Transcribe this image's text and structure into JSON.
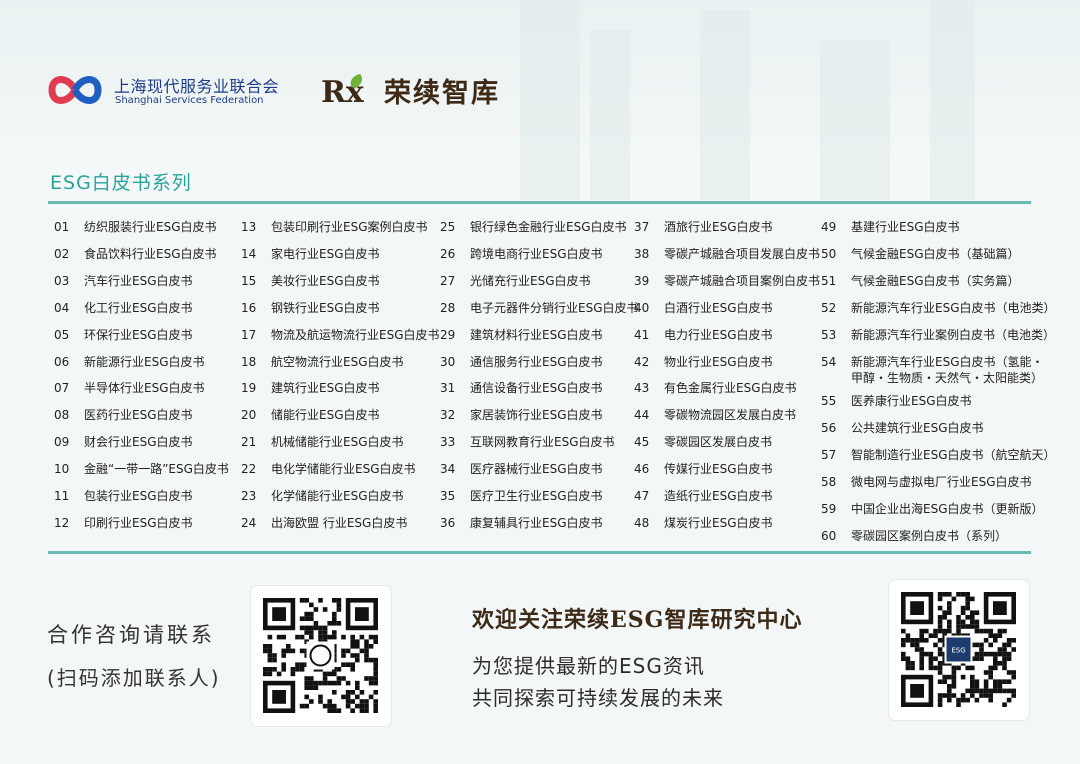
{
  "header": {
    "federation_cn": "上海现代服务业联合会",
    "federation_en": "Shanghai Services Federation",
    "brand_logo_text": "Rx",
    "brand_name": "荣续智库"
  },
  "section_title": "ESG白皮书系列",
  "colors": {
    "accent": "#2aa39a",
    "rule": "#6bb9b0",
    "brand_dark": "#3d2a16",
    "federation_blue": "#1f3c8c",
    "federation_red": "#e23a4e"
  },
  "columns": [
    [
      {
        "num": "01",
        "title": "纺织服装行业ESG白皮书"
      },
      {
        "num": "02",
        "title": "食品饮料行业ESG白皮书"
      },
      {
        "num": "03",
        "title": "汽车行业ESG白皮书"
      },
      {
        "num": "04",
        "title": "化工行业ESG白皮书"
      },
      {
        "num": "05",
        "title": "环保行业ESG白皮书"
      },
      {
        "num": "06",
        "title": "新能源行业ESG白皮书"
      },
      {
        "num": "07",
        "title": "半导体行业ESG白皮书"
      },
      {
        "num": "08",
        "title": "医药行业ESG白皮书"
      },
      {
        "num": "09",
        "title": "财会行业ESG白皮书"
      },
      {
        "num": "10",
        "title": "金融“一带一路”ESG白皮书"
      },
      {
        "num": "11",
        "title": "包装行业ESG白皮书"
      },
      {
        "num": "12",
        "title": "印刷行业ESG白皮书"
      }
    ],
    [
      {
        "num": "13",
        "title": "包装印刷行业ESG案例白皮书"
      },
      {
        "num": "14",
        "title": "家电行业ESG白皮书"
      },
      {
        "num": "15",
        "title": "美妆行业ESG白皮书"
      },
      {
        "num": "16",
        "title": "钢铁行业ESG白皮书"
      },
      {
        "num": "17",
        "title": "物流及航运物流行业ESG白皮书"
      },
      {
        "num": "18",
        "title": "航空物流行业ESG白皮书"
      },
      {
        "num": "19",
        "title": "建筑行业ESG白皮书"
      },
      {
        "num": "20",
        "title": "储能行业ESG白皮书"
      },
      {
        "num": "21",
        "title": "机械储能行业ESG白皮书"
      },
      {
        "num": "22",
        "title": "电化学储能行业ESG白皮书"
      },
      {
        "num": "23",
        "title": "化学储能行业ESG白皮书"
      },
      {
        "num": "24",
        "title": "出海欧盟 行业ESG白皮书"
      }
    ],
    [
      {
        "num": "25",
        "title": "银行绿色金融行业ESG白皮书"
      },
      {
        "num": "26",
        "title": "跨境电商行业ESG白皮书"
      },
      {
        "num": "27",
        "title": "光储充行业ESG白皮书"
      },
      {
        "num": "28",
        "title": "电子元器件分销行业ESG白皮书"
      },
      {
        "num": "29",
        "title": "建筑材料行业ESG白皮书"
      },
      {
        "num": "30",
        "title": "通信服务行业ESG白皮书"
      },
      {
        "num": "31",
        "title": "通信设备行业ESG白皮书"
      },
      {
        "num": "32",
        "title": "家居装饰行业ESG白皮书"
      },
      {
        "num": "33",
        "title": "互联网教育行业ESG白皮书"
      },
      {
        "num": "34",
        "title": "医疗器械行业ESG白皮书"
      },
      {
        "num": "35",
        "title": "医疗卫生行业ESG白皮书"
      },
      {
        "num": "36",
        "title": "康复辅具行业ESG白皮书"
      }
    ],
    [
      {
        "num": "37",
        "title": "酒旅行业ESG白皮书"
      },
      {
        "num": "38",
        "title": "零碳产城融合项目发展白皮书"
      },
      {
        "num": "39",
        "title": "零碳产城融合项目案例白皮书"
      },
      {
        "num": "40",
        "title": "白酒行业ESG白皮书"
      },
      {
        "num": "41",
        "title": "电力行业ESG白皮书"
      },
      {
        "num": "42",
        "title": "物业行业ESG白皮书"
      },
      {
        "num": "43",
        "title": "有色金属行业ESG白皮书"
      },
      {
        "num": "44",
        "title": "零碳物流园区发展白皮书"
      },
      {
        "num": "45",
        "title": "零碳园区发展白皮书"
      },
      {
        "num": "46",
        "title": "传媒行业ESG白皮书"
      },
      {
        "num": "47",
        "title": "造纸行业ESG白皮书"
      },
      {
        "num": "48",
        "title": "煤炭行业ESG白皮书"
      }
    ],
    [
      {
        "num": "49",
        "title": "基建行业ESG白皮书"
      },
      {
        "num": "50",
        "title": "气候金融ESG白皮书（基础篇）"
      },
      {
        "num": "51",
        "title": "气候金融ESG白皮书（实务篇）"
      },
      {
        "num": "52",
        "title": "新能源汽车行业ESG白皮书（电池类）"
      },
      {
        "num": "53",
        "title": "新能源汽车行业案例白皮书（电池类）"
      },
      {
        "num": "54",
        "title": "新能源汽车行业ESG白皮书（氢能・",
        "title2": "甲醇・生物质・天然气・太阳能类）"
      },
      {
        "num": "55",
        "title": "医养康行业ESG白皮书"
      },
      {
        "num": "56",
        "title": "公共建筑行业ESG白皮书"
      },
      {
        "num": "57",
        "title": "智能制造行业ESG白皮书（航空航天）"
      },
      {
        "num": "58",
        "title": "微电网与虚拟电厂行业ESG白皮书"
      },
      {
        "num": "59",
        "title": "中国企业出海ESG白皮书（更新版）"
      },
      {
        "num": "60",
        "title": "零碳园区案例白皮书（系列）"
      }
    ]
  ],
  "contact": {
    "line1": "合作咨询请联系",
    "line2": "(扫码添加联系人)"
  },
  "follow": {
    "title": "欢迎关注荣续ESG智库研究中心",
    "line1": "为您提供最新的ESG资讯",
    "line2": "共同探索可持续发展的未来",
    "qr_center_label": "ESG"
  },
  "icons": {
    "federation_logo": "federation-logo-icon",
    "brand_logo": "rx-leaf-logo-icon",
    "contact_qr": "wechat-qr-code",
    "follow_qr": "official-account-qr-code"
  }
}
